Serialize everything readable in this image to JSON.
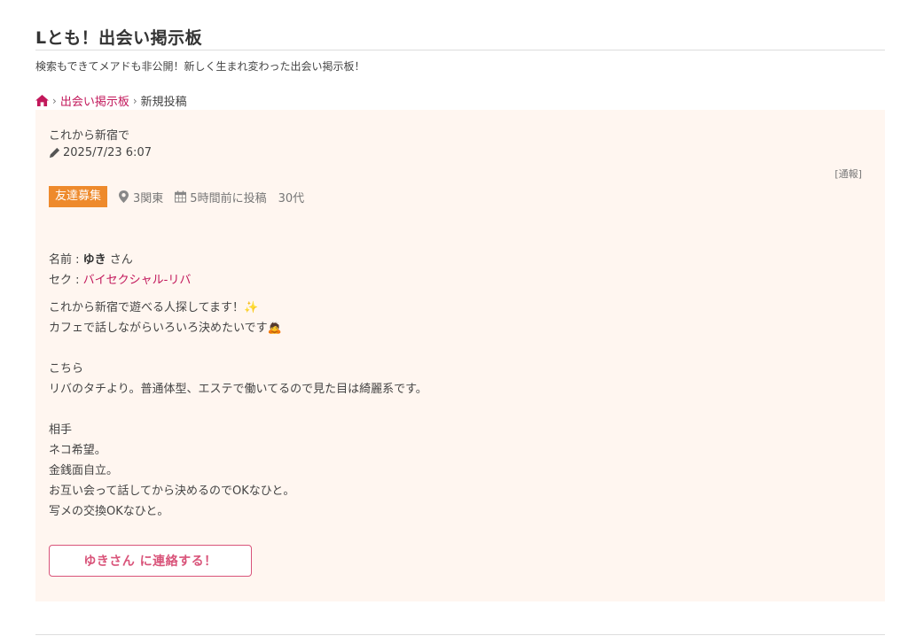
{
  "site": {
    "title": "Lとも！出会い掲示板",
    "description": "検索もできてメアドも非公開！新しく生まれ変わった出会い掲示板！"
  },
  "breadcrumb": {
    "home_icon": "home-icon",
    "separator": "›",
    "link_label": "出会い掲示板",
    "current_label": "新規投稿"
  },
  "post": {
    "title": "これから新宿で",
    "date_icon": "pencil-icon",
    "date": "2025/7/23 6:07",
    "report_label": "[通報]",
    "category": "友達募集",
    "location_icon": "map-pin-icon",
    "location": "3関東",
    "time_icon": "calendar-icon",
    "posted_ago": "5時間前に投稿",
    "age": "30代",
    "name_label": "名前 : ",
    "name": "ゆき",
    "name_suffix": " さん",
    "sex_label": "セク : ",
    "sex": "バイセクシャル-リバ",
    "body_lines": [
      "これから新宿で遊べる人探してます！✨",
      "カフェで話しながらいろいろ決めたいです🙇",
      "",
      "こちら",
      "リバのタチより。普通体型、エステで働いてるので見た目は綺麗系です。",
      "",
      "相手",
      "ネコ希望。",
      "金銭面自立。",
      "お互い会って話してから決めるのでOKなひと。",
      "写メの交換OKなひと。"
    ],
    "contact_button_label": "ゆきさん に連絡する！"
  },
  "colors": {
    "accent": "#c2185b",
    "badge": "#ee8a2c",
    "card_bg": "#fff6f0",
    "button_border": "#d9547a"
  }
}
